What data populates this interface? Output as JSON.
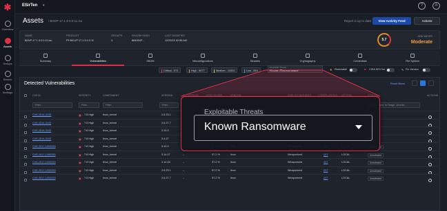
{
  "org": {
    "name": "ESirTen"
  },
  "sidebar": {
    "items": [
      {
        "label": "Overview",
        "icon": "overview-icon"
      },
      {
        "label": "Assets",
        "icon": "assets-icon",
        "active": true
      },
      {
        "label": "Groups",
        "icon": "groups-icon"
      },
      {
        "label": "Search",
        "icon": "search-icon"
      },
      {
        "label": "Settings",
        "icon": "gear-icon"
      }
    ]
  },
  "topbar": {
    "help": "?",
    "user": "A"
  },
  "header": {
    "title": "Assets",
    "crumb": "/ BIGIP-17.1.3-0.0.11.iso",
    "status": "Report is up to date",
    "view_feed": "View Activity Feed",
    "actions": "Actions"
  },
  "summary": {
    "fields": [
      {
        "key": "NAME",
        "value": "BIGIP-17.1.3-0.0.11.iso"
      },
      {
        "key": "PRODUCT",
        "value": "F5 BIG-IP 17.1.3-0.0.11"
      },
      {
        "key": "GROUPS",
        "value": "3"
      },
      {
        "key": "SHA256 HASH",
        "value": "8840D0F..."
      },
      {
        "key": "LAST MODIFIED",
        "value": "12/29/23 02:56 AM"
      }
    ],
    "risk_label": "RISK METER",
    "risk_value": "Moderate",
    "risk_score": "5.7"
  },
  "tabs": [
    {
      "label": "Summary"
    },
    {
      "label": "Vulnerabilities",
      "active": true
    },
    {
      "label": "SBOM"
    },
    {
      "label": "Misconfigurations"
    },
    {
      "label": "Binaries"
    },
    {
      "label": "Cryptography"
    },
    {
      "label": "Credentials"
    },
    {
      "label": "File System"
    }
  ],
  "filters": {
    "critical": "Critical - 572",
    "high": "High - 6077",
    "medium": "Medium - 13302",
    "low": "Low - 815",
    "exploitable_label": "Exploitable Threats",
    "exploitable_value": "Known Ransomware",
    "reachable": "Reachable",
    "cisa": "CISA KEV list",
    "fix": "Fix Version",
    "colors": {
      "critical": "#e03048",
      "high": "#e08a2a",
      "medium": "#e0c040",
      "low": "#3c9ae0"
    }
  },
  "table": {
    "title": "Detected Vulnerabilities",
    "reset": "Reset filters",
    "columns": [
      "CVE ID",
      "SEVERITY",
      "COMPONENT",
      "VERSION",
      "FIX VERSION",
      "EPSS SCORE",
      "VENDOR",
      "EXPLOIT MATURITY",
      "CORRELATIONS",
      "VECTOR",
      "STATUS",
      "ACTIONS"
    ],
    "filter_placeholder": "Filter...",
    "status_filter": "Unreviewed, In Triage, Unrevie...",
    "rows": [
      {
        "cve": "CVE-2014-3153",
        "sev": "7.8 High",
        "comp": "linux_kernel",
        "ver": "2.6.23.1"
      },
      {
        "cve": "CVE-2014-3153",
        "sev": "7.8 High",
        "comp": "linux_kernel",
        "ver": "2.6.27.7"
      },
      {
        "cve": "CVE-2014-3153",
        "sev": "7.8 High",
        "comp": "linux_kernel",
        "ver": "3.10.0"
      },
      {
        "cve": "CVE-2014-3153",
        "sev": "7.8 High",
        "comp": "linux_kernel",
        "ver": "3.4.27"
      },
      {
        "cve": "CVE-2017-1000253",
        "sev": "7.8 High",
        "comp": "linux_kernel",
        "ver": "3.10.0",
        "fix": "–",
        "epss": "57.2 %",
        "vendor": "linux",
        "maturity": "Weaponized",
        "corr": "207",
        "vector": "LOCAL",
        "status": "Unreviewed"
      },
      {
        "cve": "CVE-2017-1000253",
        "sev": "7.8 High",
        "comp": "linux_kernel",
        "ver": "3.14.17",
        "fix": "–",
        "epss": "57.2 %",
        "vendor": "linux",
        "maturity": "Weaponized",
        "corr": "207",
        "vector": "LOCAL",
        "status": "Unreviewed"
      },
      {
        "cve": "CVE-2017-1000253",
        "sev": "7.8 High",
        "comp": "linux_kernel",
        "ver": "3.14.43",
        "fix": "–",
        "epss": "57.2 %",
        "vendor": "linux",
        "maturity": "Weaponized",
        "corr": "207",
        "vector": "LOCAL",
        "status": "Unreviewed"
      },
      {
        "cve": "CVE-2017-1000253",
        "sev": "7.8 High",
        "comp": "linux_kernel",
        "ver": "2.6.23.1",
        "fix": "–",
        "epss": "57.2 %",
        "vendor": "linux",
        "maturity": "Weaponized",
        "corr": "207",
        "vector": "LOCAL",
        "status": "Unreviewed"
      },
      {
        "cve": "CVE-2017-1000253",
        "sev": "7.8 High",
        "comp": "linux_kernel",
        "ver": "2.6.27.7",
        "fix": "–",
        "epss": "57.2 %",
        "vendor": "linux",
        "maturity": "Weaponized",
        "corr": "207",
        "vector": "LOCAL",
        "status": "Unreviewed"
      }
    ]
  },
  "overlay": {
    "label": "Exploitable Threats",
    "value": "Known Ransomware"
  }
}
